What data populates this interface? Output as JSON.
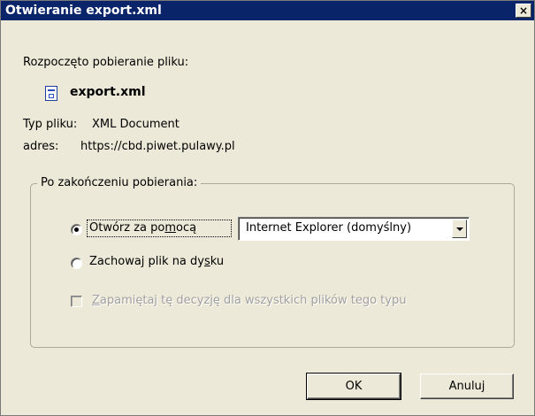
{
  "window": {
    "title": "Otwieranie export.xml",
    "close_glyph": "×"
  },
  "info": {
    "intro": "Rozpoczęto pobieranie pliku:",
    "file_icon": "xml-document-icon",
    "filename": "export.xml",
    "type_label": "Typ pliku:",
    "type_value": "XML Document",
    "address_label": "adres:",
    "address_value": "https://cbd.piwet.pulawy.pl"
  },
  "group": {
    "legend": "Po zakończeniu pobierania:",
    "open_with": {
      "label_pre": "Otwórz za po",
      "label_accel": "m",
      "label_post": "ocą",
      "checked": true
    },
    "program_select": {
      "selected": "Internet Explorer (domyślny)"
    },
    "save": {
      "label_pre": "Zachowaj plik na dy",
      "label_accel": "s",
      "label_post": "ku",
      "checked": false
    },
    "remember": {
      "label_accel": "Z",
      "label_post": "apamiętaj tę decyzję dla wszystkich plików tego typu",
      "checked": false,
      "disabled": true
    }
  },
  "buttons": {
    "ok": "OK",
    "cancel": "Anuluj"
  },
  "colors": {
    "titlebar": "#0a246a",
    "face": "#ece9d8",
    "disabled_text": "#a0a0a0"
  }
}
